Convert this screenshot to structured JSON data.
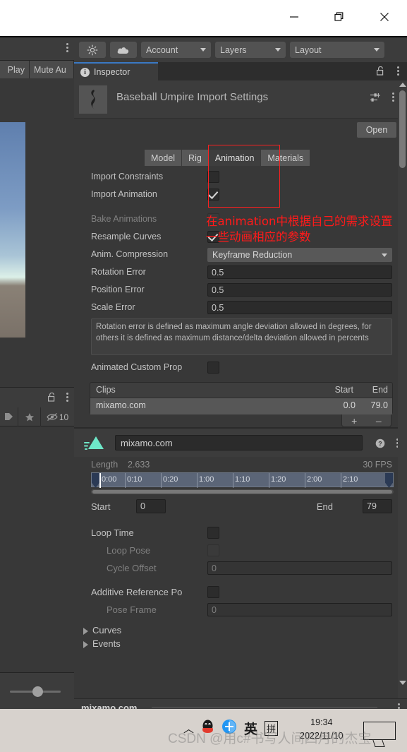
{
  "window": {
    "minimize_label": "minimize-icon",
    "maximize_label": "restore-icon",
    "close_label": "close-icon"
  },
  "left_panel": {
    "tabs": [
      "Play",
      "Mute Au"
    ],
    "visibility_count": "10"
  },
  "toolbar": {
    "effects_icon": "light-icon",
    "cloud_icon": "cloud-icon",
    "account": "Account",
    "layers": "Layers",
    "layout": "Layout"
  },
  "inspector": {
    "tab_label": "Inspector",
    "info_glyph": "i",
    "title": "Baseball Umpire Import Settings",
    "open_button": "Open",
    "tabs": [
      {
        "label": "Model",
        "active": false
      },
      {
        "label": "Rig",
        "active": false
      },
      {
        "label": "Animation",
        "active": true
      },
      {
        "label": "Materials",
        "active": false
      }
    ],
    "properties": [
      {
        "label": "Import Constraints",
        "type": "checkbox",
        "checked": false,
        "disabled": false
      },
      {
        "label": "Import Animation",
        "type": "checkbox",
        "checked": true,
        "disabled": false
      },
      {
        "label": "Bake Animations",
        "type": "checkbox",
        "checked": false,
        "disabled": true
      },
      {
        "label": "Resample Curves",
        "type": "checkbox",
        "checked": true,
        "disabled": false
      }
    ],
    "anim_compression_label": "Anim. Compression",
    "anim_compression_value": "Keyframe Reduction",
    "rotation_error_label": "Rotation Error",
    "rotation_error_value": "0.5",
    "position_error_label": "Position Error",
    "position_error_value": "0.5",
    "scale_error_label": "Scale Error",
    "scale_error_value": "0.5",
    "help_text": "Rotation error is defined as maximum angle deviation allowed in degrees, for others it is defined as maximum distance/delta deviation allowed in percents",
    "animated_custom_prop_label": "Animated Custom Prop"
  },
  "clips": {
    "header": [
      "Clips",
      "Start",
      "End"
    ],
    "rows": [
      {
        "name": "mixamo.com",
        "start": "0.0",
        "end": "79.0"
      }
    ],
    "add_label": "+",
    "remove_label": "–"
  },
  "clip_inspector": {
    "name_value": "mixamo.com",
    "length_label": "Length",
    "length_value": "2.633",
    "fps_value": "30 FPS",
    "ruler_ticks": [
      "0:00",
      "0:10",
      "0:20",
      "1:00",
      "1:10",
      "1:20",
      "2:00",
      "2:10"
    ],
    "start_label": "Start",
    "start_value": "0",
    "end_label": "End",
    "end_value": "79",
    "loop_time_label": "Loop Time",
    "loop_time_checked": false,
    "loop_pose_label": "Loop Pose",
    "loop_pose_checked": false,
    "cycle_offset_label": "Cycle Offset",
    "cycle_offset_value": "0",
    "additive_ref_label": "Additive Reference Po",
    "additive_ref_checked": false,
    "pose_frame_label": "Pose Frame",
    "pose_frame_value": "0",
    "curves_label": "Curves",
    "events_label": "Events"
  },
  "annotation": {
    "text": "在animation中根据自己的需求设置一些动画相应的参数",
    "color": "#ff1a1a"
  },
  "status_bar": {
    "asset_name": "mixamo.com"
  },
  "taskbar": {
    "ime_cn": "英",
    "ime_pin": "拼",
    "time": "19:34",
    "date": "2022/11/10"
  },
  "watermark": {
    "text": "CSDN @用c#书写人间四月的杰宝"
  },
  "colors": {
    "accent_tab": "#3a79c4",
    "panel": "#383838",
    "toolbar": "#3c3c3c",
    "annotation_red": "#ff1a1a",
    "clip_icon_teal": "#6ee7c8"
  }
}
